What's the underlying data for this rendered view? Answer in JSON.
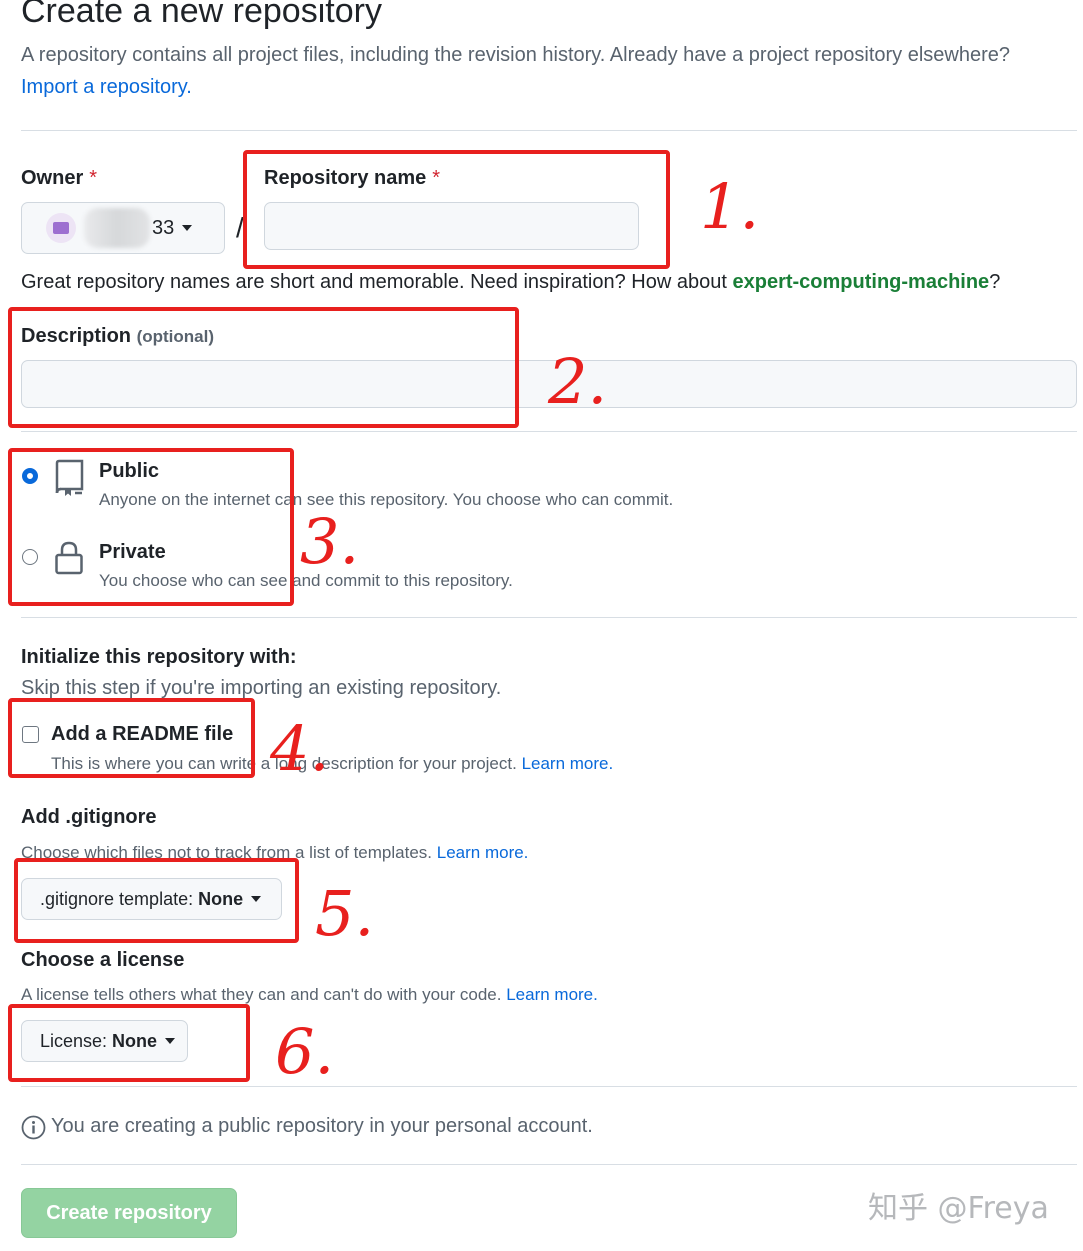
{
  "header": {
    "title": "Create a new repository",
    "subtitle": "A repository contains all project files, including the revision history. Already have a project repository elsewhere?",
    "import_link": "Import a repository."
  },
  "owner": {
    "label": "Owner",
    "required_mark": "*",
    "name_suffix": "33",
    "slash": "/"
  },
  "repo_name": {
    "label": "Repository name",
    "required_mark": "*",
    "value": ""
  },
  "name_hint": {
    "prefix": "Great repository names are short and memorable. Need inspiration? How about ",
    "suggestion": "expert-computing-machine",
    "suffix": "?"
  },
  "description": {
    "label": "Description",
    "optional": "(optional)",
    "value": ""
  },
  "visibility": {
    "options": [
      {
        "title": "Public",
        "desc": "Anyone on the internet can see this repository. You choose who can commit.",
        "selected": true,
        "icon": "repo-icon"
      },
      {
        "title": "Private",
        "desc": "You choose who can see and commit to this repository.",
        "selected": false,
        "icon": "lock-icon"
      }
    ]
  },
  "initialize": {
    "heading": "Initialize this repository with:",
    "note": "Skip this step if you're importing an existing repository.",
    "readme_label": "Add a README file",
    "readme_desc": "This is where you can write a long description for your project.",
    "readme_learn_more": "Learn more.",
    "readme_checked": false
  },
  "gitignore": {
    "heading": "Add .gitignore",
    "note": "Choose which files not to track from a list of templates.",
    "learn_more": "Learn more.",
    "select_prefix": ".gitignore template:",
    "select_value": "None"
  },
  "license": {
    "heading": "Choose a license",
    "note": "A license tells others what they can and can't do with your code.",
    "learn_more": "Learn more.",
    "select_prefix": "License:",
    "select_value": "None"
  },
  "info": {
    "text": "You are creating a public repository in your personal account."
  },
  "submit": {
    "label": "Create repository"
  },
  "watermark": "知乎 @Freya",
  "annotations": [
    "1.",
    "2.",
    "3.",
    "4.",
    "5.",
    "6."
  ],
  "colors": {
    "link": "#0969da",
    "suggestion": "#1a7f37",
    "required": "#d1242f",
    "create_button_disabled": "#94d3a2",
    "annotation_red": "#e8201e"
  }
}
